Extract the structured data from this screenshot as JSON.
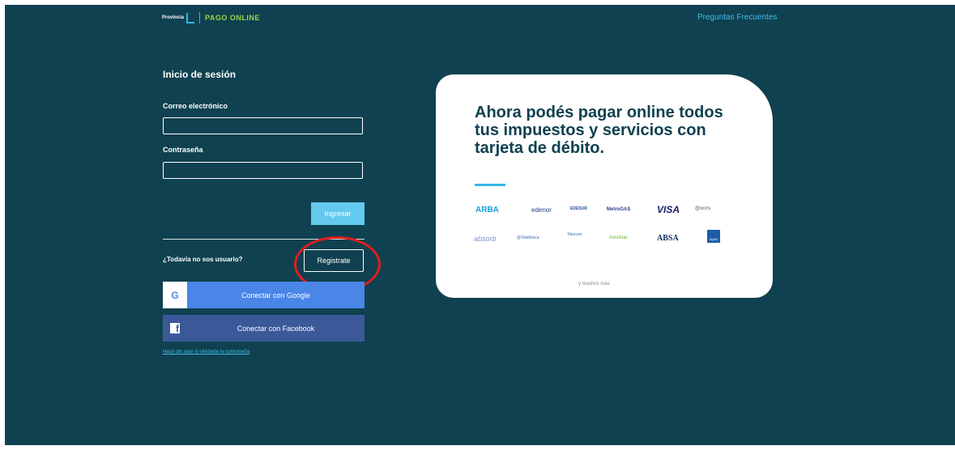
{
  "header": {
    "brand_small": "Provincia",
    "brand_title": "PAGO ONLINE",
    "faq_link": "Preguntas Frecuentes"
  },
  "login": {
    "title": "Inicio de sesión",
    "email_label": "Correo electrónico",
    "email_value": "",
    "password_label": "Contraseña",
    "password_value": "",
    "submit_label": "Ingresar",
    "not_user_text": "¿Todavía no sos usuario?",
    "register_label": "Registrate",
    "google_label": "Conectar con Google",
    "google_icon_glyph": "G",
    "facebook_label": "Conectar con Facebook",
    "facebook_icon_glyph": "f",
    "forgot_text": "Hacé clic aquí si olvidaste tu contraseña"
  },
  "promo": {
    "headline": "Ahora podés pagar online todos tus impuestos y servicios con tarjeta de débito.",
    "logos": [
      {
        "name": "ARBA",
        "color": "#1aa0d8"
      },
      {
        "name": "edenor",
        "color": "#2a3f8f"
      },
      {
        "name": "EDESUR",
        "color": "#1c4a9a"
      },
      {
        "name": "MetroGAS",
        "color": "#2a3f8f"
      },
      {
        "name": "VISA",
        "color": "#1a1f71"
      },
      {
        "name": "@ocrrs",
        "color": "#555555"
      },
      {
        "name": "absorb",
        "color": "#7d94c4"
      },
      {
        "name": "@Telefonica",
        "color": "#3a6bb5"
      },
      {
        "name": "Telecom",
        "color": "#2a6ab5"
      },
      {
        "name": "movistar",
        "color": "#6ab531"
      },
      {
        "name": "ABSA",
        "color": "#0f2f5a"
      },
      {
        "name": "AySA",
        "color": "#1a5fa8"
      }
    ],
    "more_text": "y muchos más"
  },
  "colors": {
    "background": "#0f4150",
    "accent": "#33b7e6",
    "brand_green": "#9ed34d",
    "highlight": "#e21d1d"
  }
}
